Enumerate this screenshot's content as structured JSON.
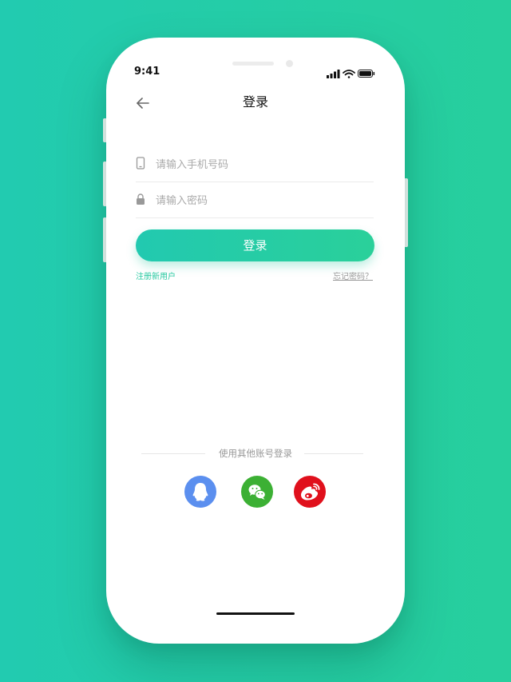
{
  "status_bar": {
    "time": "9:41"
  },
  "nav": {
    "title": "登录"
  },
  "form": {
    "phone_placeholder": "请输入手机号码",
    "password_placeholder": "请输入密码",
    "login_label": "登录",
    "register_label": "注册新用户",
    "forgot_label": "忘记密码？"
  },
  "other_login": {
    "label": "使用其他账号登录",
    "providers": [
      {
        "icon": "qq-icon",
        "color": "#5b8fef"
      },
      {
        "icon": "wechat-icon",
        "color": "#3cb034"
      },
      {
        "icon": "weibo-icon",
        "color": "#e0101c"
      }
    ]
  },
  "colors": {
    "background_start": "#22cbb0",
    "background_end": "#27cf9d",
    "accent": "#27c8a0",
    "link_muted": "#999999"
  }
}
